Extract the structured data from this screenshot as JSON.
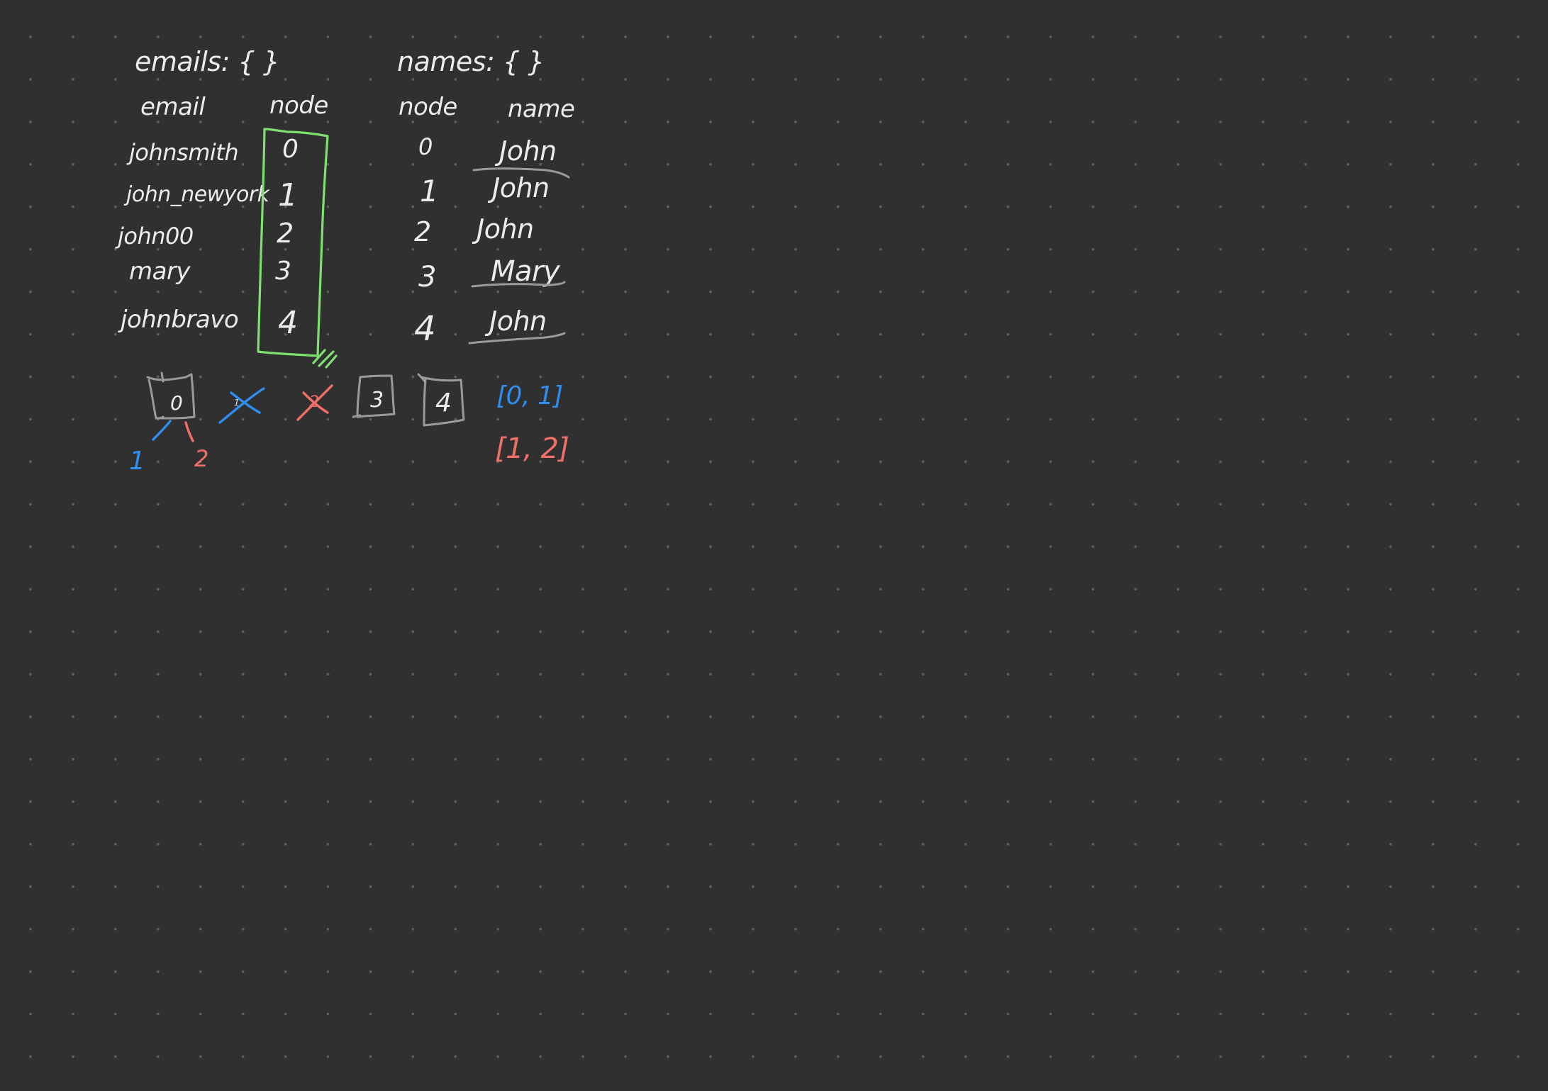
{
  "whiteboard": {
    "emails_label": "emails: { }",
    "names_label": "names: { }",
    "emails_table": {
      "headers": [
        "email",
        "node"
      ],
      "rows": [
        [
          "johnsmith",
          "0"
        ],
        [
          "john_newyork",
          "1"
        ],
        [
          "john00",
          "2"
        ],
        [
          "mary",
          "3"
        ],
        [
          "johnbravo",
          "4"
        ]
      ]
    },
    "names_table": {
      "headers": [
        "node",
        "name"
      ],
      "rows": [
        [
          "0",
          "John"
        ],
        [
          "1",
          "John"
        ],
        [
          "2",
          "John"
        ],
        [
          "3",
          "Mary"
        ],
        [
          "4",
          "John"
        ]
      ]
    },
    "tree": {
      "root_node": "0",
      "crossed_node_blue": "1",
      "crossed_node_red": "2",
      "box_node_3": "3",
      "box_node_4": "4",
      "child_left": "1",
      "child_right": "2"
    },
    "groups": {
      "blue_group": "[0, 1]",
      "red_group": "[1, 2]"
    },
    "colors": {
      "background": "#303030",
      "grid_dot": "#5e5e5e",
      "ink_white": "#ececec",
      "ink_gray": "#9a9a9a",
      "ink_green": "#7ee06e",
      "ink_blue": "#2f8df0",
      "ink_red": "#f07068"
    }
  }
}
